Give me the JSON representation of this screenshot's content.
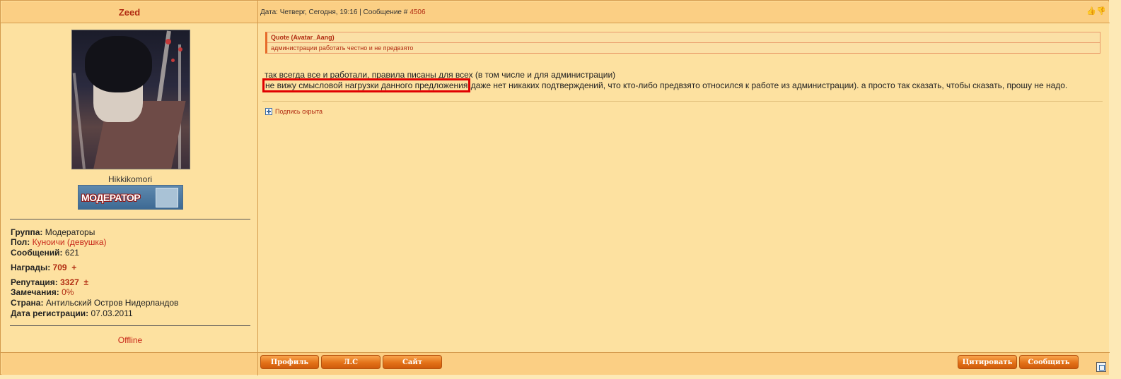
{
  "author": {
    "name": "Zeed",
    "user_title": "Hikkikomori",
    "rank_badge": "МОДЕРАТОР",
    "status": "Offline",
    "info": [
      {
        "label": "Группа:",
        "value": "Модераторы"
      },
      {
        "label": "Пол:",
        "value": "Куноичи (девушка)"
      },
      {
        "label": "Сообщений:",
        "value": "621"
      },
      {
        "label": "Награды:",
        "value": "709",
        "action": "+"
      },
      {
        "label": "Репутация:",
        "value": "3327",
        "action": "±"
      },
      {
        "label": "Замечания:",
        "value": "0%"
      },
      {
        "label": "Страна:",
        "value": "Антильский Остров Нидерландов"
      },
      {
        "label": "Дата регистрации:",
        "value": "07.03.2011"
      }
    ]
  },
  "post": {
    "header_prefix": "Дата: Четверг, Сегодня, 19:16 | Сообщение #",
    "message_number": "4506",
    "quote": {
      "author": "Quote (Avatar_Aang)",
      "text": "администрации работать честно и не предвзято"
    },
    "line1": "так всегда все и работали, правила писаны для всех (в том числе и для администрации)",
    "line2_highlight": "не вижу смысловой нагрузки данного предложения",
    "line2_rest": " даже нет никаких подтверждений, что кто-либо предвзято относился к работе из администрации). а просто так сказать, чтобы сказать, прошу не надо.",
    "signature_label": "Подпись скрыта"
  },
  "buttons": {
    "profile": "Профиль",
    "pm": "Л.С",
    "site": "Сайт",
    "quote": "Цитировать",
    "report": "Сообщить"
  },
  "icons": {
    "vote_up": "thumbs-up-icon",
    "vote_down": "thumbs-down-icon",
    "signature_toggle": "plus-box-icon",
    "corner": "page-icon"
  },
  "colors": {
    "background": "#fde1a0",
    "header": "#fbcf84",
    "accent": "#b12c12",
    "button": "#e37218",
    "highlight": "#e00000"
  }
}
